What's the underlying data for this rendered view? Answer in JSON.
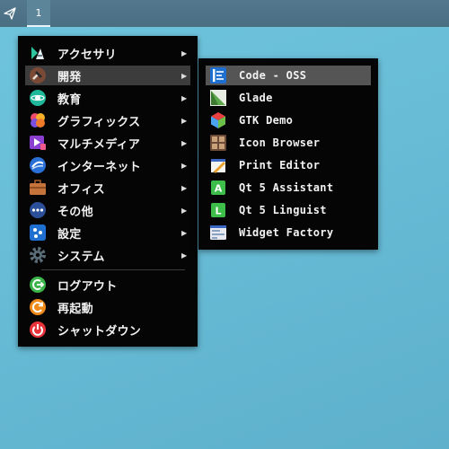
{
  "panel": {
    "workspace_label": "1"
  },
  "main_menu": {
    "items": [
      {
        "label": "アクセサリ"
      },
      {
        "label": "開発"
      },
      {
        "label": "教育"
      },
      {
        "label": "グラフィックス"
      },
      {
        "label": "マルチメディア"
      },
      {
        "label": "インターネット"
      },
      {
        "label": "オフィス"
      },
      {
        "label": "その他"
      },
      {
        "label": "設定"
      },
      {
        "label": "システム"
      }
    ],
    "actions": [
      {
        "label": "ログアウト"
      },
      {
        "label": "再起動"
      },
      {
        "label": "シャットダウン"
      }
    ],
    "arrow": "▶"
  },
  "sub_menu": {
    "items": [
      {
        "label": "Code - OSS"
      },
      {
        "label": "Glade"
      },
      {
        "label": "GTK Demo"
      },
      {
        "label": "Icon Browser"
      },
      {
        "label": "Print Editor"
      },
      {
        "label": "Qt 5 Assistant"
      },
      {
        "label": "Qt 5 Linguist"
      },
      {
        "label": "Widget Factory"
      }
    ]
  },
  "colors": {
    "desktop": "#69bdd7",
    "panel": "#4e7387",
    "menu_bg": "#050505",
    "highlight": "#3c3c3c"
  }
}
